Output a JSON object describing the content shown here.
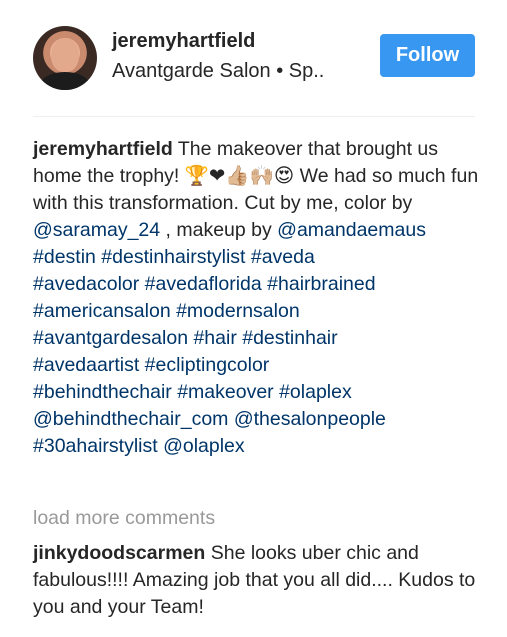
{
  "post_header": {
    "username": "jeremyhartfield",
    "location": "Avantgarde Salon • Sp..",
    "follow_label": "Follow"
  },
  "caption": {
    "username": "jeremyhartfield",
    "text_1": " The makeover that brought us home the trophy! 🏆❤👍🏼🙌🏼😍 We had so much fun with this transformation. Cut by me, color by ",
    "mention_1": "@saramay_24",
    "text_2": " , makeup by ",
    "mention_2": "@amandaemaus",
    "tags_line_1": "#destin #destinhairstylist #aveda",
    "tags_line_2": "#avedacolor #avedaflorida #hairbrained",
    "tags_line_3": "#americansalon #modernsalon",
    "tags_line_4": "#avantgardesalon #hair #destinhair",
    "tags_line_5": "#avedaartist #ecliptingcolor",
    "tags_line_6": "#behindthechair #makeover #olaplex",
    "tags_line_7": "@behindthechair_com @thesalonpeople",
    "tags_line_8": "#30ahairstylist @olaplex"
  },
  "load_more_label": "load more comments",
  "comments": [
    {
      "username": "jinkydoodscarmen",
      "text": " She looks uber chic and fabulous!!!! Amazing job that you all did.... Kudos to you and your Team!"
    }
  ],
  "colors": {
    "follow_button": "#3897f0",
    "link": "#003569",
    "muted": "#999999"
  }
}
